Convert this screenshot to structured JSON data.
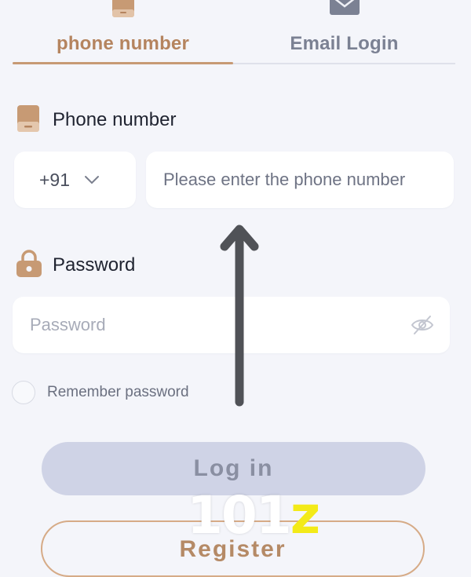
{
  "tabs": [
    {
      "label": "phone number",
      "active": true,
      "icon": "phone-icon"
    },
    {
      "label": "Email Login",
      "active": false,
      "icon": "mail-icon"
    }
  ],
  "phone_section": {
    "label": "Phone number",
    "icon": "phone-icon",
    "country_code": "+91",
    "placeholder": "Please enter the phone number"
  },
  "password_section": {
    "label": "Password",
    "icon": "lock-icon",
    "placeholder": "Password"
  },
  "remember": {
    "label": "Remember password",
    "checked": false
  },
  "buttons": {
    "login": "Log in",
    "register": "Register"
  },
  "watermark": {
    "number": "101",
    "letter": "z"
  },
  "colors": {
    "accent": "#c79a74",
    "tab_inactive": "#7b8193",
    "background": "#f4f5fa",
    "login_button": "#cfd3e6",
    "watermark_yellow": "#f3ea18"
  }
}
